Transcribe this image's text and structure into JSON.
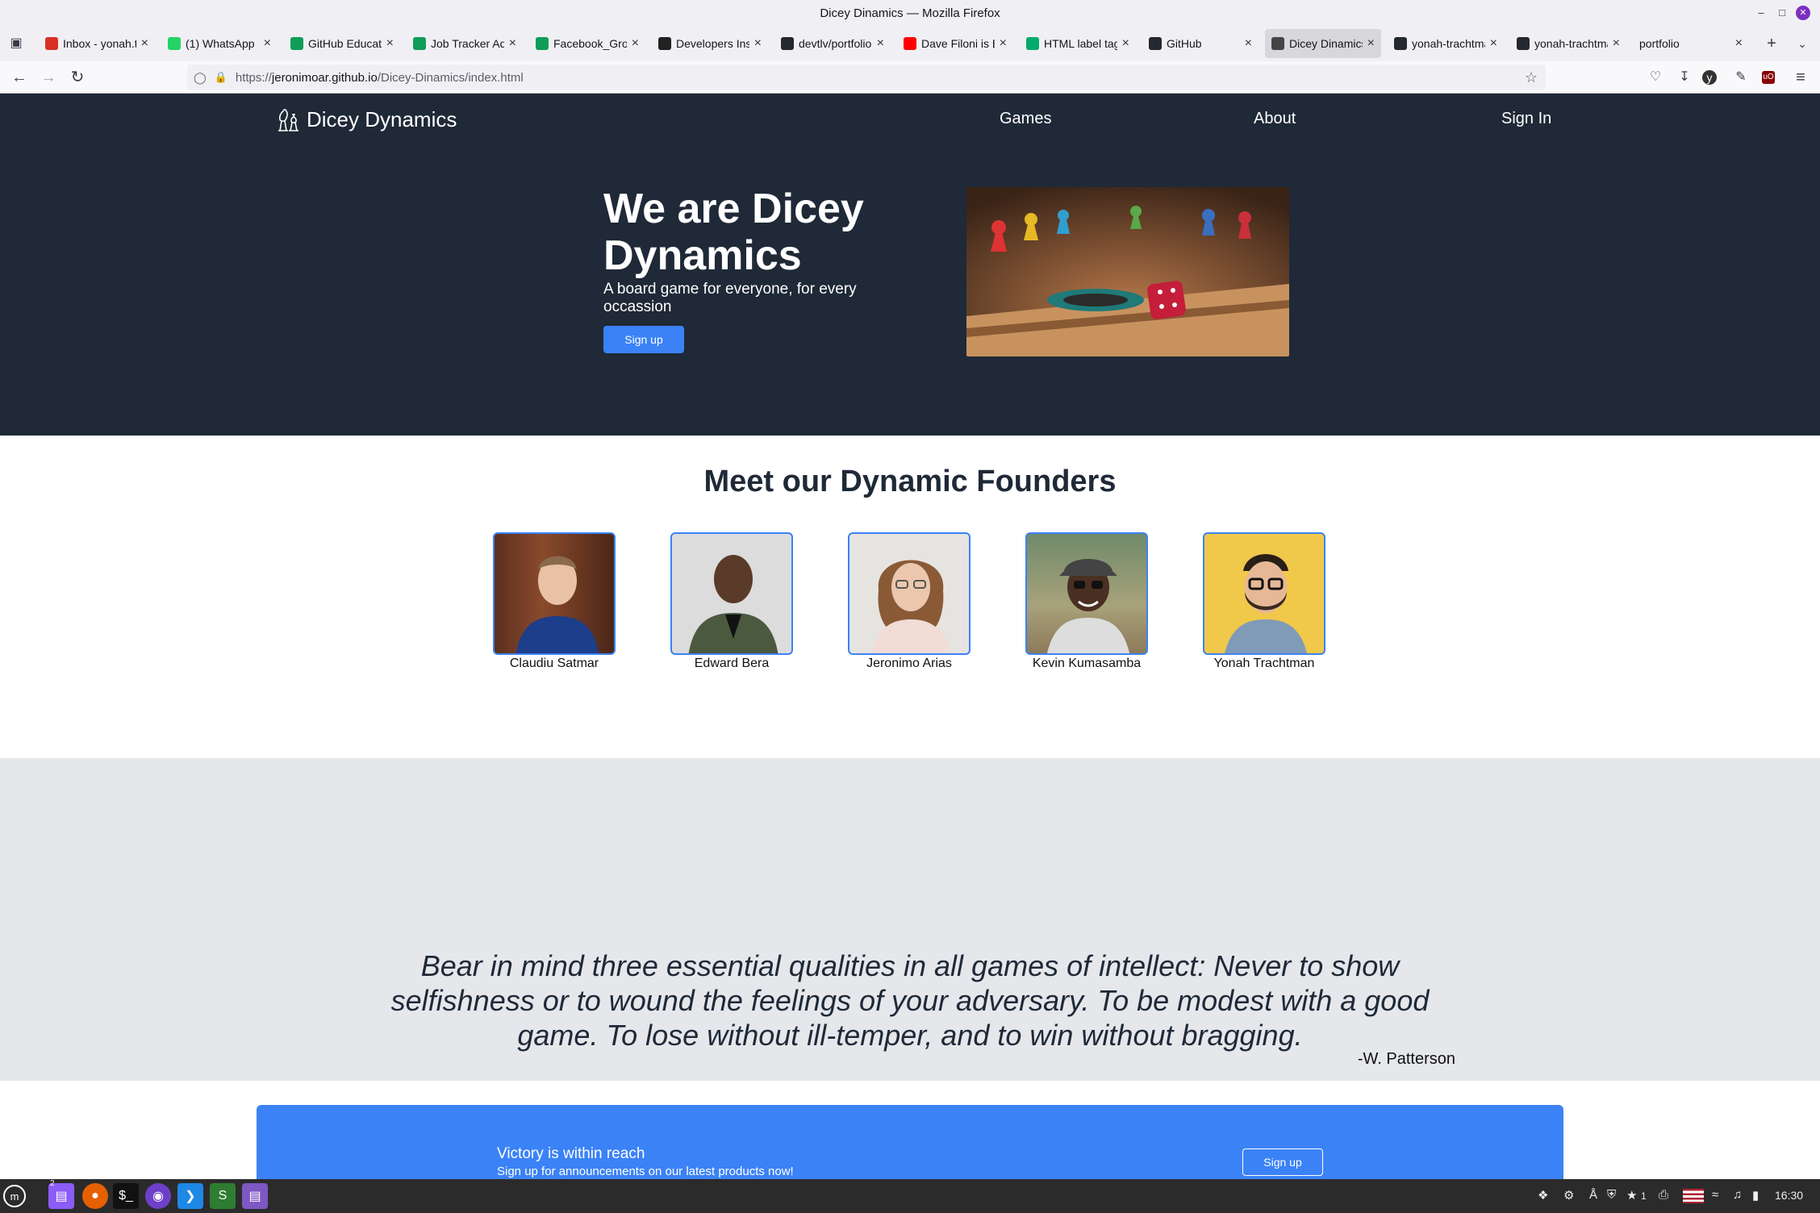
{
  "window": {
    "title": "Dicey Dinamics — Mozilla Firefox"
  },
  "tabs": [
    {
      "label": "Inbox - yonah.tr",
      "icon": "gmail-icon",
      "color": "#d93025",
      "active": false
    },
    {
      "label": "(1) WhatsApp",
      "icon": "whatsapp-icon",
      "color": "#25d366",
      "active": false
    },
    {
      "label": "GitHub Educatio",
      "icon": "sheets-icon",
      "color": "#0f9d58",
      "active": false
    },
    {
      "label": "Job Tracker Adr",
      "icon": "sheets-icon",
      "color": "#0f9d58",
      "active": false
    },
    {
      "label": "Facebook_Grou",
      "icon": "sheets-icon",
      "color": "#0f9d58",
      "active": false
    },
    {
      "label": "Developers Inst",
      "icon": "code-icon",
      "color": "#222222",
      "active": false
    },
    {
      "label": "devtlv/portfolio",
      "icon": "github-icon",
      "color": "#24292f",
      "active": false
    },
    {
      "label": "Dave Filoni is B",
      "icon": "youtube-icon",
      "color": "#ff0000",
      "active": false
    },
    {
      "label": "HTML label tag",
      "icon": "w3schools-icon",
      "color": "#04aa6d",
      "active": false
    },
    {
      "label": "GitHub",
      "icon": "github-icon",
      "color": "#24292f",
      "active": false
    },
    {
      "label": "Dicey Dinamics",
      "icon": "site-icon",
      "color": "#444444",
      "active": true
    },
    {
      "label": "yonah-trachtma",
      "icon": "github-icon",
      "color": "#24292f",
      "active": false
    },
    {
      "label": "yonah-trachtma",
      "icon": "github-icon",
      "color": "#24292f",
      "active": false
    },
    {
      "label": "portfolio",
      "icon": "",
      "color": "",
      "active": false
    }
  ],
  "urlbar": {
    "prefix": "https://",
    "domain": "jeronimoar.github.io",
    "path": "/Dicey-Dinamics/index.html"
  },
  "site": {
    "brand": "Dicey Dynamics",
    "nav": {
      "games": "Games",
      "about": "About",
      "signin": "Sign In"
    },
    "hero": {
      "title": "We are Dicey Dynamics",
      "subtitle": "A board game for everyone, for every occassion",
      "button": "Sign up"
    },
    "founders_title": "Meet our Dynamic Founders",
    "founders": [
      {
        "name": "Claudiu Satmar"
      },
      {
        "name": "Edward Bera"
      },
      {
        "name": "Jeronimo Arias"
      },
      {
        "name": "Kevin Kumasamba"
      },
      {
        "name": "Yonah Trachtman"
      }
    ],
    "quote": {
      "text": "Bear in mind three essential qualities in all games of intellect: Never to show selfishness or to wound the feelings of your adversary. To be modest with a good game. To lose without ill-temper, and to win without bragging.",
      "author": "-W. Patterson"
    },
    "cta": {
      "title": "Victory is within reach",
      "subtitle": "Sign up for announcements on our latest products now!",
      "button": "Sign up"
    }
  },
  "colors": {
    "nav_bg": "#1f2937",
    "accent": "#3b82f6",
    "quote_bg": "#e5e7eb"
  },
  "taskbar": {
    "clock": "16:30",
    "workspace": "2",
    "notifications": "1"
  }
}
